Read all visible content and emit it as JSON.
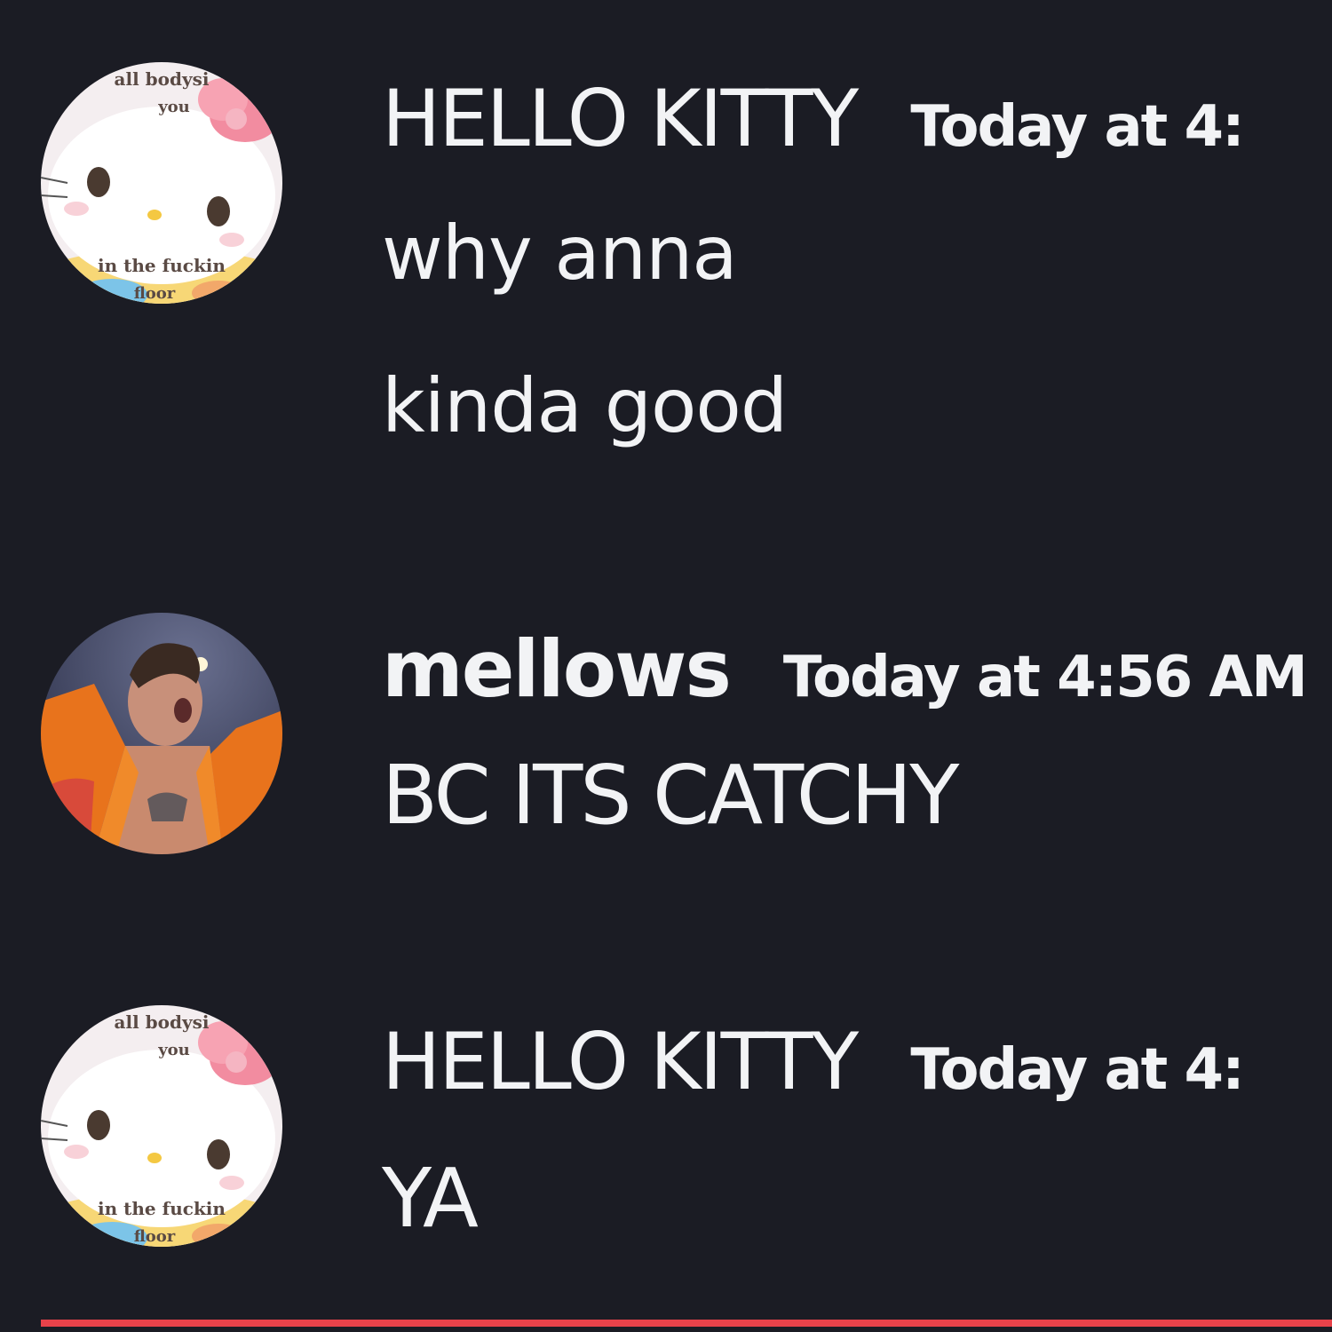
{
  "messages": [
    {
      "author": "HELLO KITTY",
      "timestamp": "Today at 4:",
      "avatar_icon": "hello-kitty-avatar",
      "avatar_text": [
        "all bodysi",
        "you",
        "in the fuckin",
        "floor"
      ],
      "lines": [
        "why anna",
        "kinda good"
      ]
    },
    {
      "author": "mellows",
      "timestamp": "Today at 4:56 AM",
      "avatar_icon": "performer-photo-avatar",
      "lines": [
        "BC ITS CATCHY"
      ]
    },
    {
      "author": "HELLO KITTY",
      "timestamp": "Today at 4:",
      "avatar_icon": "hello-kitty-avatar",
      "avatar_text": [
        "all bodysi",
        "you",
        "in the fuckin",
        "floor"
      ],
      "lines": [
        "YA"
      ]
    }
  ],
  "colors": {
    "background": "#1b1c24",
    "text": "#f2f3f5",
    "new_messages_divider": "#e8424a"
  }
}
